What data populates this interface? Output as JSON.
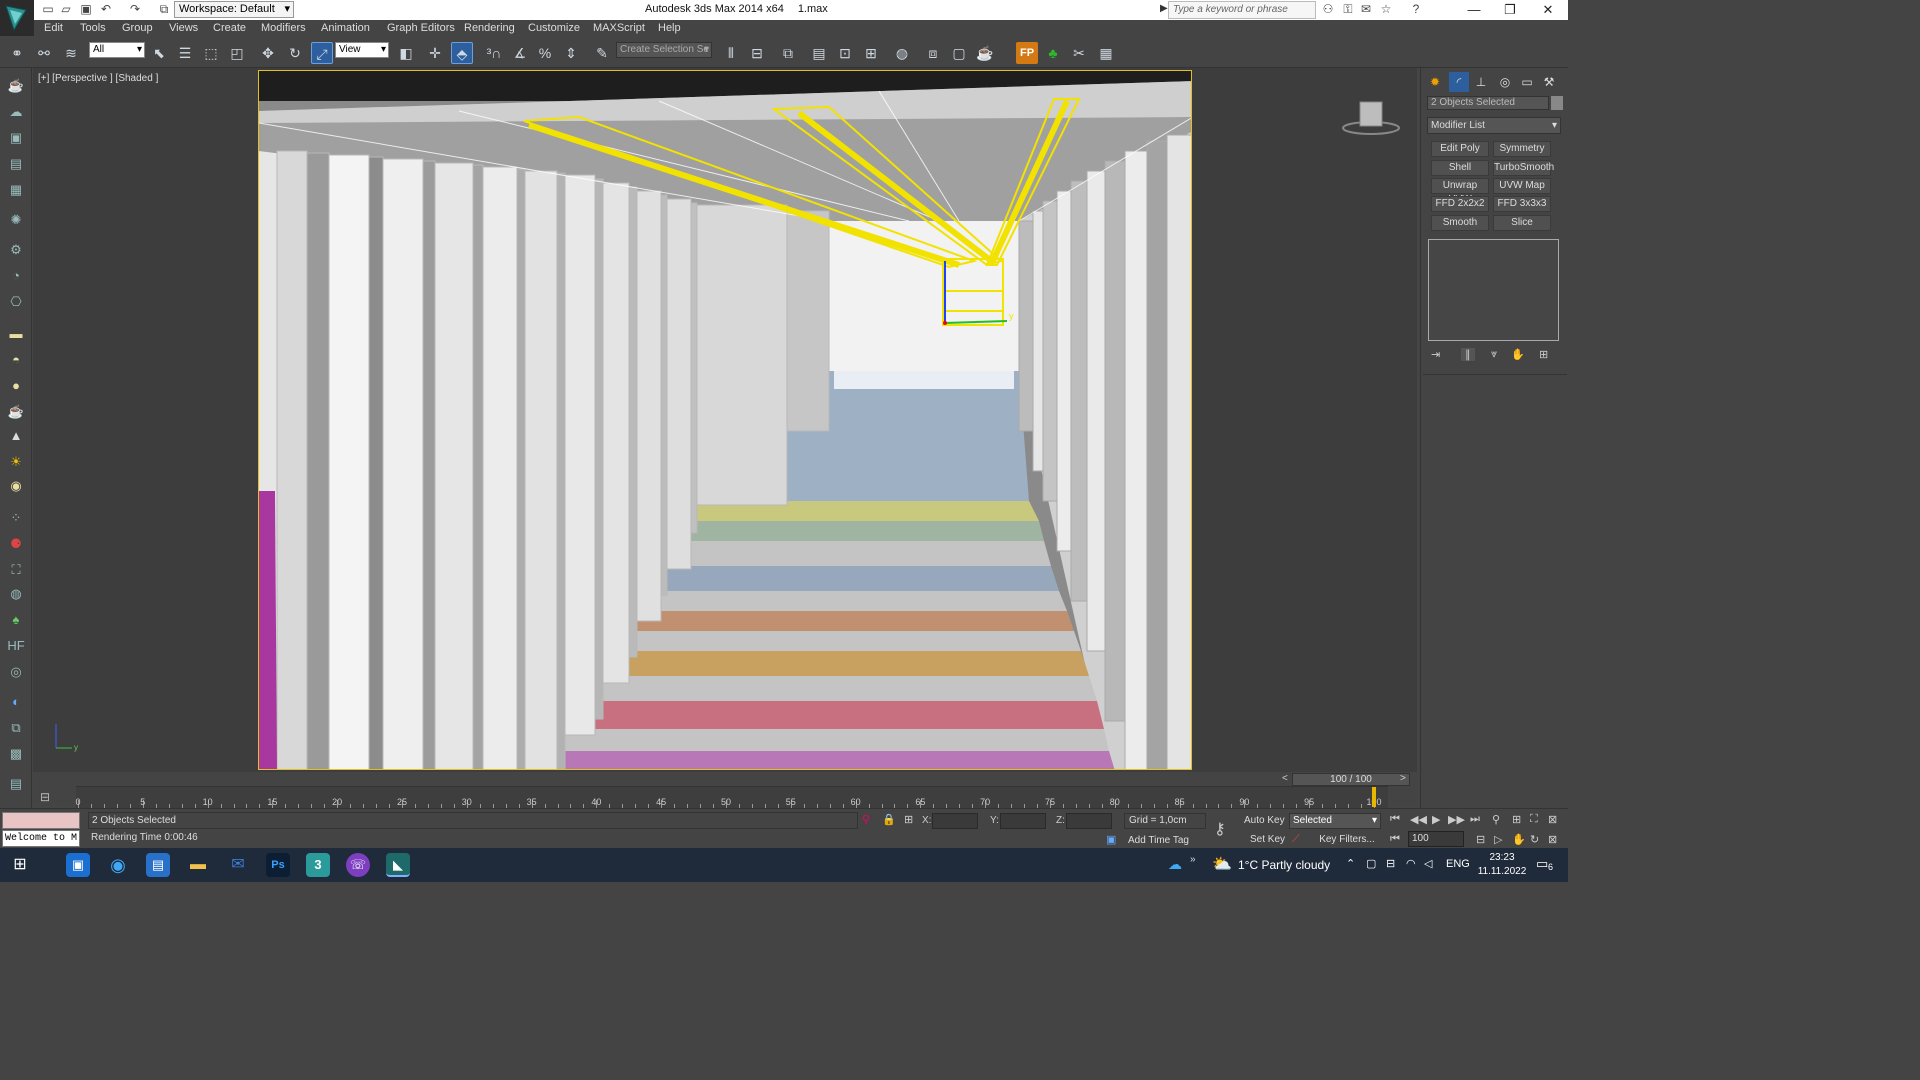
{
  "titlebar": {
    "workspace": "Workspace: Default",
    "app_title": "Autodesk 3ds Max  2014 x64",
    "file_name": "1.max",
    "search_placeholder": "Type a keyword or phrase"
  },
  "menu": [
    "Edit",
    "Tools",
    "Group",
    "Views",
    "Create",
    "Modifiers",
    "Animation",
    "Graph Editors",
    "Rendering",
    "Customize",
    "MAXScript",
    "Help"
  ],
  "toolbar": {
    "selection_filter": "All",
    "reference_coord": "View",
    "selection_set_placeholder": "Create Selection Se"
  },
  "viewport": {
    "label": "[+] [Perspective ] [Shaded ]"
  },
  "command_panel": {
    "selection_info": "2 Objects Selected",
    "modifier_list": "Modifier List",
    "modifier_buttons": [
      "Edit Poly",
      "Symmetry",
      "Shell",
      "TurboSmooth",
      "Unwrap UVW",
      "UVW Map",
      "FFD 2x2x2",
      "FFD 3x3x3",
      "Smooth",
      "Slice"
    ]
  },
  "timeline": {
    "slider_text": "100 / 100",
    "current_frame": 100,
    "ruler_labels": [
      "0",
      "5",
      "10",
      "15",
      "20",
      "25",
      "30",
      "35",
      "40",
      "45",
      "50",
      "55",
      "60",
      "65",
      "70",
      "75",
      "80",
      "85",
      "90",
      "95",
      "100"
    ]
  },
  "status": {
    "maxscript_listener": "Welcome to M:",
    "selected_info": "2 Objects Selected",
    "render_time": "Rendering Time  0:00:46",
    "x_label": "X:",
    "y_label": "Y:",
    "z_label": "Z:",
    "grid": "Grid = 1,0cm",
    "auto_key": "Auto Key",
    "set_key": "Set Key",
    "key_mode": "Selected",
    "key_filters": "Key Filters...",
    "add_time_tag": "Add Time Tag",
    "frame_field": "100"
  },
  "taskbar": {
    "weather": "1°C  Partly cloudy",
    "language": "ENG",
    "time": "23:23",
    "date": "11.11.2022",
    "notification_count": "6"
  },
  "colors": {
    "selection_yellow": "#f2e200",
    "highlight_blue": "#2d5f9e"
  }
}
